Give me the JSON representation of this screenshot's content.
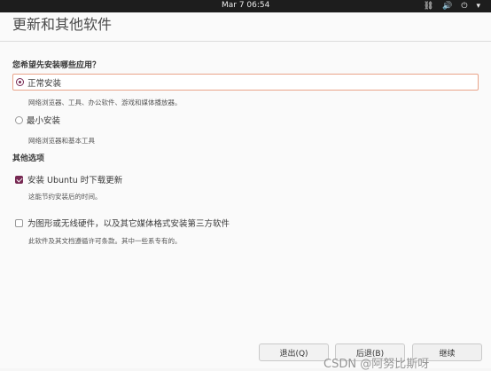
{
  "topbar": {
    "clock": "Mar 7  06:54",
    "icons": [
      "network-icon",
      "volume-icon",
      "power-icon"
    ]
  },
  "window": {
    "title": "更新和其他软件"
  },
  "installation": {
    "heading": "您希望先安装哪些应用？",
    "options": [
      {
        "label": "正常安装",
        "description": "网络浏览器、工具、办公软件、游戏和媒体播放器。",
        "selected": true
      },
      {
        "label": "最小安装",
        "description": "网络浏览器和基本工具",
        "selected": false
      }
    ]
  },
  "other": {
    "heading": "其他选项",
    "checkboxes": [
      {
        "label": "安装 Ubuntu 时下载更新",
        "description": "这能节约安装后的时间。",
        "checked": true
      },
      {
        "label": "为图形或无线硬件，以及其它媒体格式安装第三方软件",
        "description": "此软件及其文档遵循许可条款。其中一些系专有的。",
        "checked": false
      }
    ]
  },
  "footer": {
    "quit_label": "退出(Q)",
    "back_label": "后退(B)",
    "continue_label": "继续"
  },
  "watermark": {
    "text": "CSDN @阿努比斯呀"
  },
  "colors": {
    "accent": "#772953",
    "focus_border": "#e9a48a",
    "topbar": "#1d1d1d"
  }
}
